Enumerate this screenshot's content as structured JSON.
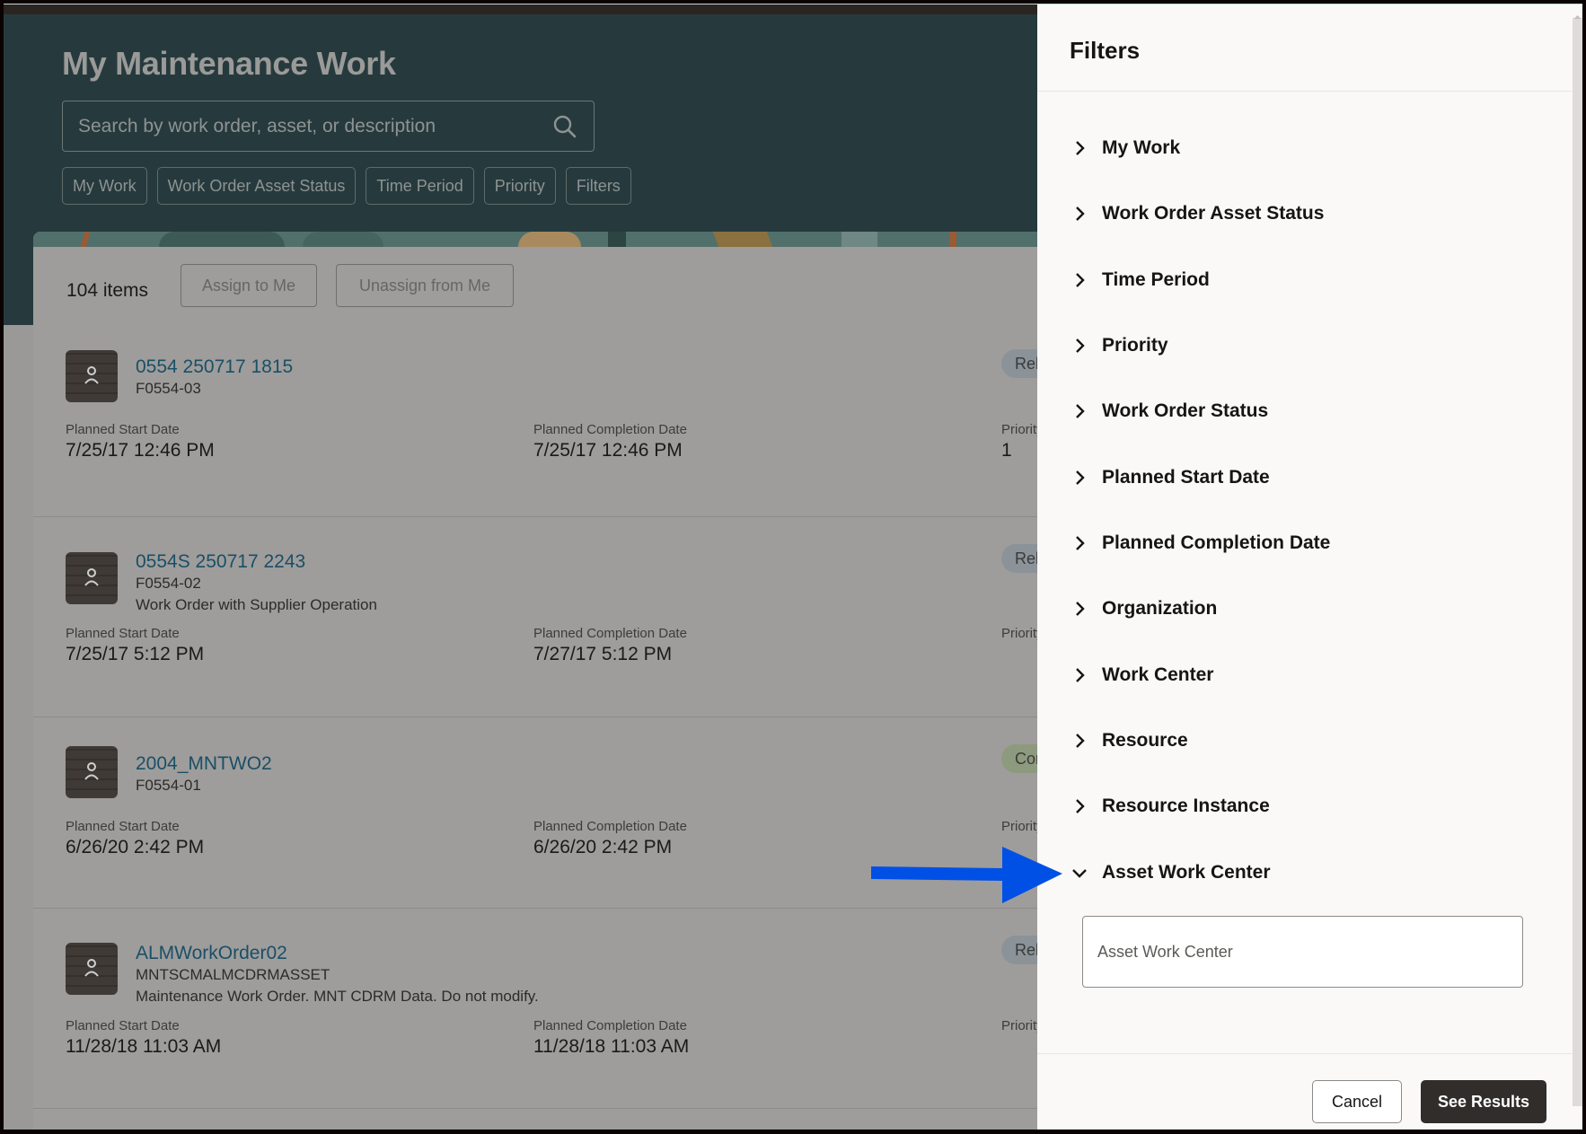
{
  "page": {
    "title": "My Maintenance Work",
    "search": {
      "placeholder": "Search by work order, asset, or description",
      "value": "",
      "icon": "search-icon"
    },
    "filter_chips": [
      "My Work",
      "Work Order Asset Status",
      "Time Period",
      "Priority",
      "Filters"
    ]
  },
  "list": {
    "count_label": "104 items",
    "actions": {
      "assign": "Assign to Me",
      "unassign": "Unassign from Me"
    },
    "labels": {
      "start": "Planned Start Date",
      "completion": "Planned Completion Date",
      "priority": "Priority"
    },
    "items": [
      {
        "work_order": "0554 250717 1815",
        "asset": "F0554-03",
        "description": "",
        "start": "7/25/17 12:46 PM",
        "completion": "7/25/17 12:46 PM",
        "priority": "1",
        "status": "Released",
        "status_visible": "Rele"
      },
      {
        "work_order": "0554S 250717 2243",
        "asset": "F0554-02",
        "description": "Work Order with Supplier Operation",
        "start": "7/25/17 5:12 PM",
        "completion": "7/27/17 5:12 PM",
        "priority": "",
        "status": "Released",
        "status_visible": "Rele"
      },
      {
        "work_order": "2004_MNTWO2",
        "asset": "F0554-01",
        "description": "",
        "start": "6/26/20 2:42 PM",
        "completion": "6/26/20 2:42 PM",
        "priority": "",
        "status": "Completed",
        "status_visible": "Cor"
      },
      {
        "work_order": "ALMWorkOrder02",
        "asset": "MNTSCMALMCDRMASSET",
        "description": "Maintenance Work Order. MNT CDRM Data. Do not modify.",
        "start": "11/28/18 11:03 AM",
        "completion": "11/28/18 11:03 AM",
        "priority": "",
        "status": "Released",
        "status_visible": "Rele"
      }
    ]
  },
  "drawer": {
    "title": "Filters",
    "sections": [
      {
        "label": "My Work",
        "expanded": false
      },
      {
        "label": "Work Order Asset Status",
        "expanded": false
      },
      {
        "label": "Time Period",
        "expanded": false
      },
      {
        "label": "Priority",
        "expanded": false
      },
      {
        "label": "Work Order Status",
        "expanded": false
      },
      {
        "label": "Planned Start Date",
        "expanded": false
      },
      {
        "label": "Planned Completion Date",
        "expanded": false
      },
      {
        "label": "Organization",
        "expanded": false
      },
      {
        "label": "Work Center",
        "expanded": false
      },
      {
        "label": "Resource",
        "expanded": false
      },
      {
        "label": "Resource Instance",
        "expanded": false
      },
      {
        "label": "Asset Work Center",
        "expanded": true
      }
    ],
    "asset_work_center_input": {
      "placeholder": "Asset Work Center",
      "value": ""
    },
    "cancel_label": "Cancel",
    "see_results_label": "See Results"
  },
  "annotation": {
    "type": "arrow",
    "color": "#0050e6",
    "points_to": "Asset Work Center"
  },
  "colors": {
    "header_bg": "#263a3e",
    "link": "#1b4f67",
    "primary_button": "#312d2a",
    "drawer_bg": "#faf9f8"
  }
}
